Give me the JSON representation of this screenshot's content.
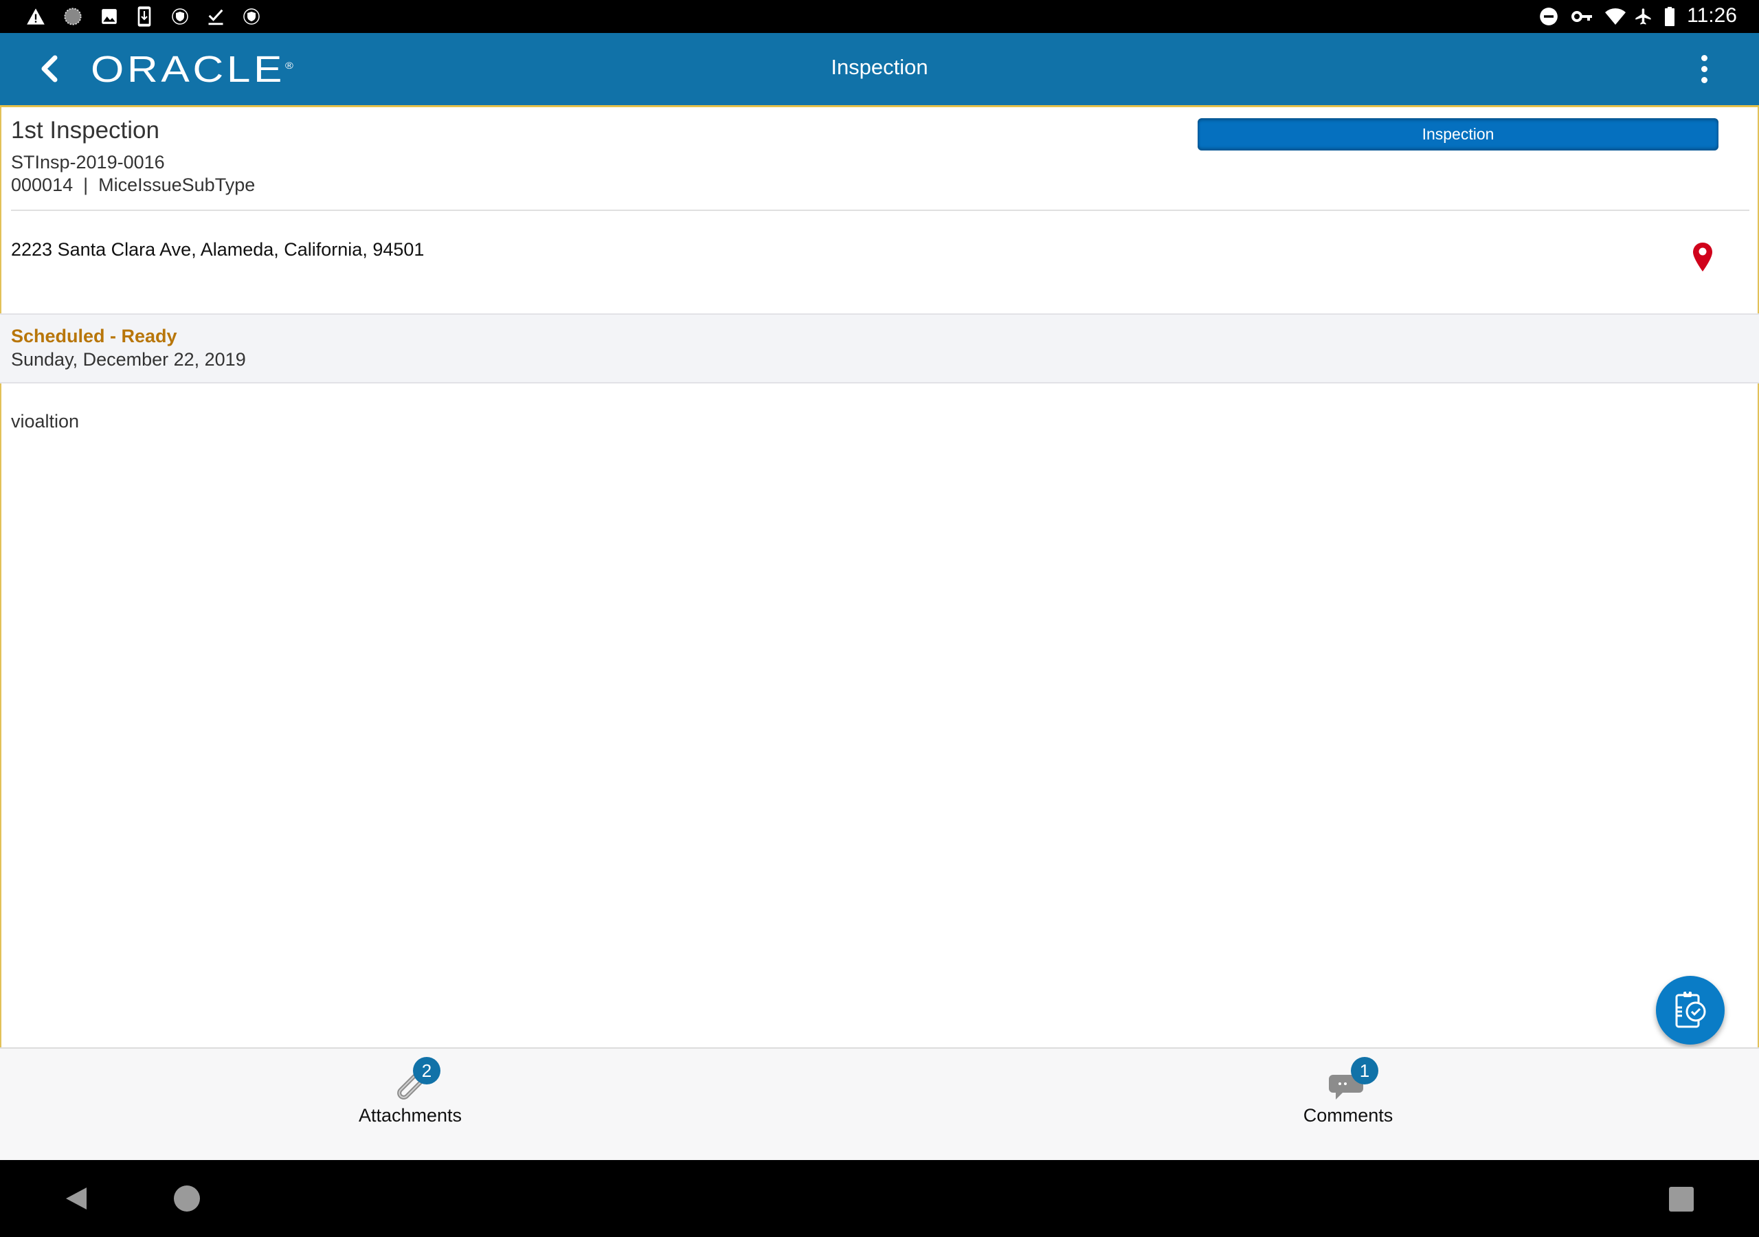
{
  "status_bar": {
    "left_icons": [
      "warning-icon",
      "sync-icon",
      "image-icon",
      "download-icon",
      "vpn-shield-icon",
      "check-icon",
      "vpn-shield-icon"
    ],
    "right_icons": [
      "do-not-disturb-icon",
      "key-icon",
      "wifi-icon",
      "airplane-icon",
      "battery-icon"
    ],
    "time": "11:26"
  },
  "header": {
    "logo": "ORACLE",
    "logo_mark": "®",
    "title": "Inspection",
    "colors": {
      "bar": "#1172a8"
    }
  },
  "inspection": {
    "title": "1st Inspection",
    "record_id": "STInsp-2019-0016",
    "record_type": "000014  |  MiceIssueSubType",
    "type_button": "Inspection",
    "address": "2223 Santa Clara Ave, Alameda, California, 94501"
  },
  "schedule": {
    "status": "Scheduled - Ready",
    "status_color": "#b8760a",
    "date": "Sunday, December 22, 2019"
  },
  "description": "vioaltion",
  "bottom_tabs": [
    {
      "label": "Attachments",
      "icon": "paperclip-icon",
      "count": "2"
    },
    {
      "label": "Comments",
      "icon": "comment-icon",
      "count": "1"
    }
  ],
  "fab": {
    "icon": "clipboard-check-icon"
  },
  "nav_bar": [
    "back",
    "home",
    "recents"
  ]
}
